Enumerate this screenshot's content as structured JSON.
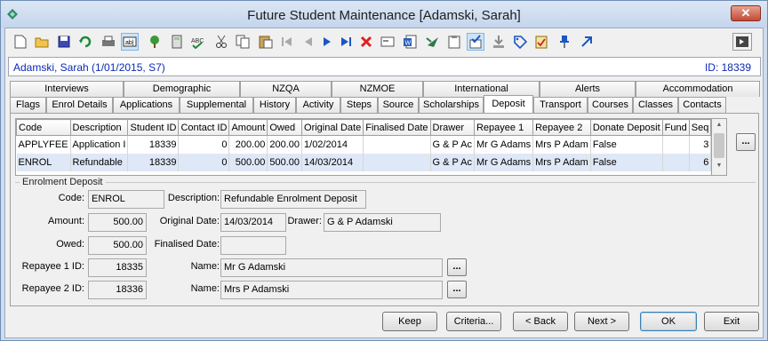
{
  "window": {
    "title": "Future Student Maintenance  [Adamski, Sarah]",
    "close_label": "✕"
  },
  "toolbar": {
    "icons": [
      "new-icon",
      "open-icon",
      "save-icon",
      "refresh-icon",
      "print-icon",
      "text-field-icon",
      "tree-icon",
      "calculator-icon",
      "spell-check-icon",
      "cut-icon",
      "copy-icon",
      "paste-icon",
      "first-record-icon",
      "previous-record-icon",
      "next-record-icon",
      "last-record-icon",
      "delete-icon",
      "card-icon",
      "word-icon",
      "send-icon",
      "clipboard-icon",
      "approve-icon",
      "download-icon",
      "tag-icon",
      "checklist-icon",
      "pin-icon",
      "arrow-icon",
      "exit-app-icon"
    ]
  },
  "header": {
    "student": "Adamski, Sarah (1/01/2015, S7)",
    "id_text": "ID: 18339"
  },
  "tabs": {
    "row1": [
      "Interviews",
      "Demographic",
      "NZQA",
      "NZMOE",
      "International",
      "Alerts",
      "Accommodation"
    ],
    "row2": [
      "Flags",
      "Enrol Details",
      "Applications",
      "Supplemental",
      "History",
      "Activity",
      "Steps",
      "Source",
      "Scholarships",
      "Deposit",
      "Transport",
      "Courses",
      "Classes",
      "Contacts"
    ],
    "active": "Deposit"
  },
  "grid": {
    "columns": [
      "Code",
      "Description",
      "Student ID",
      "Contact ID",
      "Amount",
      "Owed",
      "Original Date",
      "Finalised Date",
      "Drawer",
      "Repayee 1",
      "Repayee 2",
      "Donate Deposit",
      "Fund",
      "Seq"
    ],
    "rows": [
      [
        "APPLYFEE",
        "Application I",
        "18339",
        "0",
        "200.00",
        "200.00",
        "1/02/2014",
        "",
        "G & P Ac",
        "Mr G Adams",
        "Mrs P Adam",
        "False",
        "",
        "3"
      ],
      [
        "ENROL",
        "Refundable",
        "18339",
        "0",
        "500.00",
        "500.00",
        "14/03/2014",
        "",
        "G & P Ac",
        "Mr G Adams",
        "Mrs P Adam",
        "False",
        "",
        "6"
      ]
    ]
  },
  "deposit": {
    "group_title": "Enrolment Deposit",
    "labels": {
      "code": "Code:",
      "description": "Description:",
      "amount": "Amount:",
      "original_date": "Original Date:",
      "drawer": "Drawer:",
      "owed": "Owed:",
      "finalised_date": "Finalised Date:",
      "repayee1_id": "Repayee 1 ID:",
      "repayee2_id": "Repayee 2 ID:",
      "name1": "Name:",
      "name2": "Name:"
    },
    "values": {
      "code": "ENROL",
      "description": "Refundable Enrolment Deposit",
      "amount": "500.00",
      "original_date": "14/03/2014",
      "drawer": "G & P Adamski",
      "owed": "500.00",
      "finalised_date": "",
      "repayee1_id": "18335",
      "repayee2_id": "18336",
      "name1": "Mr G Adamski",
      "name2": "Mrs P Adamski"
    },
    "ellipsis": "..."
  },
  "buttons": {
    "keep": "Keep",
    "criteria": "Criteria...",
    "back": "< Back",
    "next": "Next >",
    "ok": "OK",
    "exit": "Exit"
  }
}
